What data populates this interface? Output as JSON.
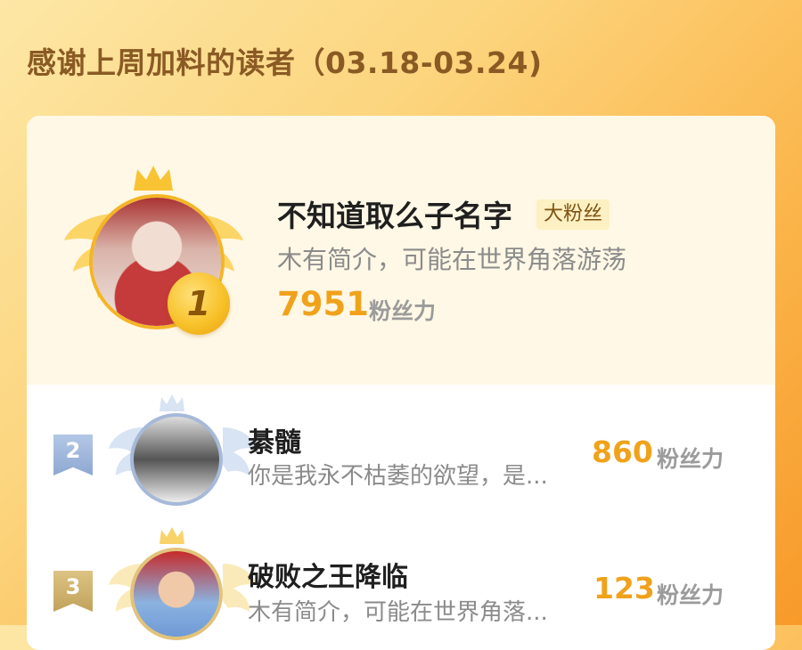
{
  "header": {
    "title": "感谢上周加料的读者（03.18-03.24)"
  },
  "first": {
    "rank": "1",
    "name": "不知道取么子名字",
    "tag": "大粉丝",
    "bio": "木有简介，可能在世界角落游荡",
    "score": "7951",
    "unit": "粉丝力"
  },
  "ranking": [
    {
      "rank": "2",
      "name": "綦髓",
      "bio": "你是我永不枯萎的欲望，是...",
      "score": "860",
      "unit": "粉丝力"
    },
    {
      "rank": "3",
      "name": "破败之王降临",
      "bio": "木有简介，可能在世界角落...",
      "score": "123",
      "unit": "粉丝力"
    }
  ],
  "colors": {
    "accent": "#f0a21b",
    "title": "#8a5a24",
    "gold": "#f4b526",
    "silver": "#a7b9d8",
    "bronze": "#e2c37b"
  },
  "icons": [
    "crown-icon",
    "wing-left-icon",
    "wing-right-icon",
    "rank-medal-icon",
    "rank-flag-icon"
  ]
}
